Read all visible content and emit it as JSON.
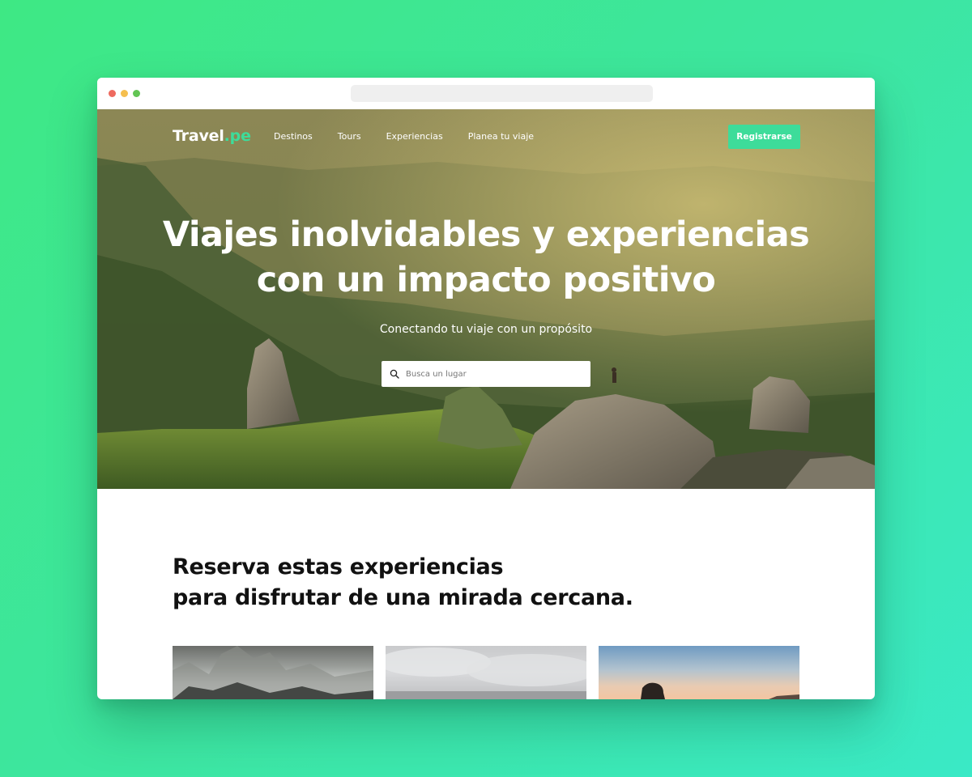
{
  "window": {
    "traffic_lights": [
      "close",
      "minimize",
      "maximize"
    ]
  },
  "nav": {
    "logo_main": "Travel",
    "logo_accent": ".pe",
    "links": [
      "Destinos",
      "Tours",
      "Experiencias",
      "Planea tu viaje"
    ],
    "register_label": "Registrarse"
  },
  "hero": {
    "title_line1": "Viajes inolvidables y experiencias",
    "title_line2": "con un impacto positivo",
    "subtitle": "Conectando tu viaje con un propósito",
    "search_placeholder": "Busca un lugar",
    "search_icon": "search-icon"
  },
  "experiences": {
    "heading_line1": "Reserva estas experiencias",
    "heading_line2": "para disfrutar de una mirada cercana."
  },
  "colors": {
    "accent": "#3ddc9a",
    "background_start": "#3ee884",
    "background_end": "#3ae9c6",
    "heading_text": "#111111"
  }
}
